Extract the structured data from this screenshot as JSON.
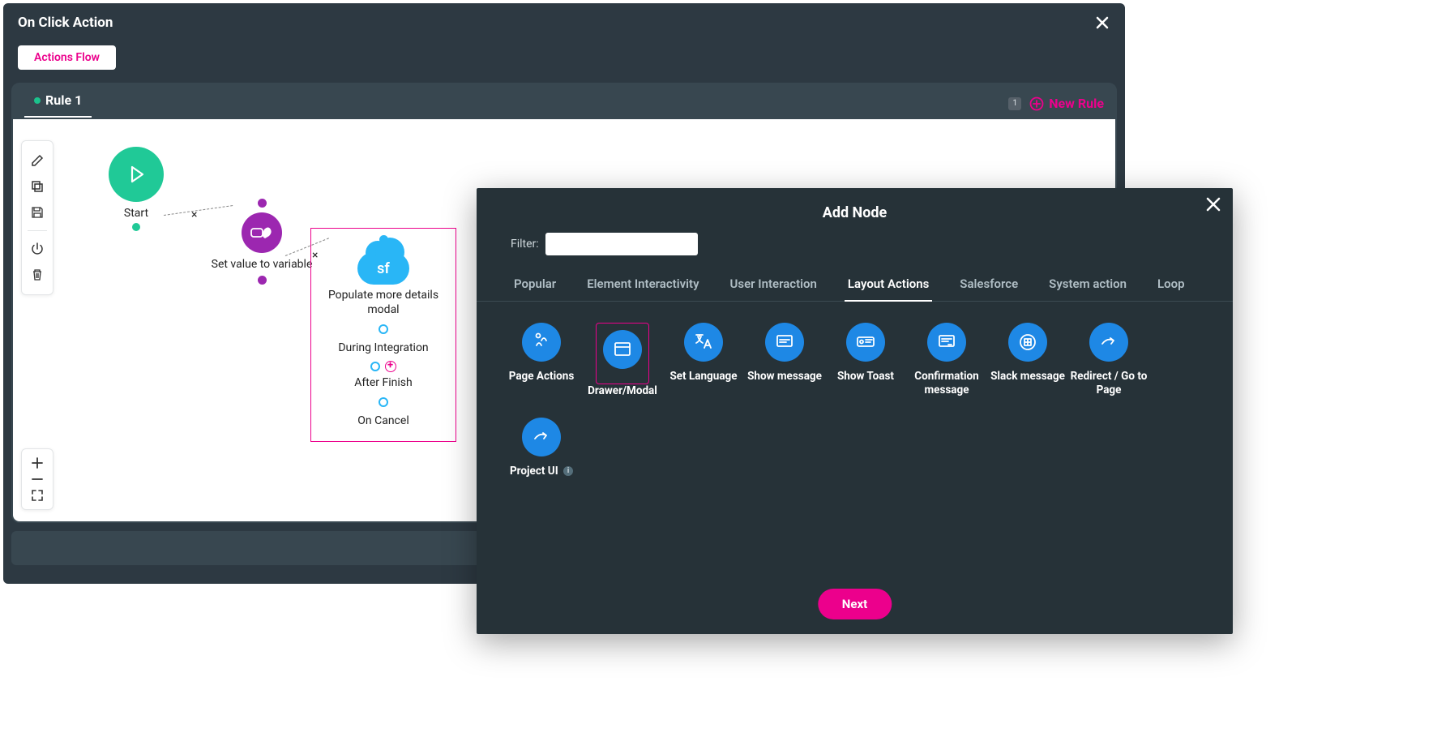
{
  "header": {
    "title": "On Click Action",
    "pill": "Actions Flow"
  },
  "rulebar": {
    "tab": "Rule 1",
    "counter": "1",
    "new": "New Rule"
  },
  "flow": {
    "start": "Start",
    "variable": "Set value to variable",
    "sf_title": "Populate more details modal",
    "during": "During Integration",
    "after": "After Finish",
    "cancel": "On Cancel",
    "cloud": "sf"
  },
  "panel": {
    "title": "Add Node",
    "filter_label": "Filter:",
    "filter_value": "",
    "tabs": [
      "Popular",
      "Element Interactivity",
      "User Interaction",
      "Layout Actions",
      "Salesforce",
      "System action",
      "Loop"
    ],
    "active_tab": "Layout Actions",
    "items": [
      {
        "label": "Page Actions",
        "icon": "run"
      },
      {
        "label": "Drawer/Modal",
        "icon": "drawer",
        "selected": true
      },
      {
        "label": "Set Language",
        "icon": "lang"
      },
      {
        "label": "Show message",
        "icon": "msg"
      },
      {
        "label": "Show Toast",
        "icon": "toast"
      },
      {
        "label": "Confirmation message",
        "icon": "confirm"
      },
      {
        "label": "Slack message",
        "icon": "slack"
      },
      {
        "label": "Redirect / Go to Page",
        "icon": "redirect"
      },
      {
        "label": "Project UI",
        "icon": "project",
        "info": true
      }
    ],
    "next": "Next"
  }
}
